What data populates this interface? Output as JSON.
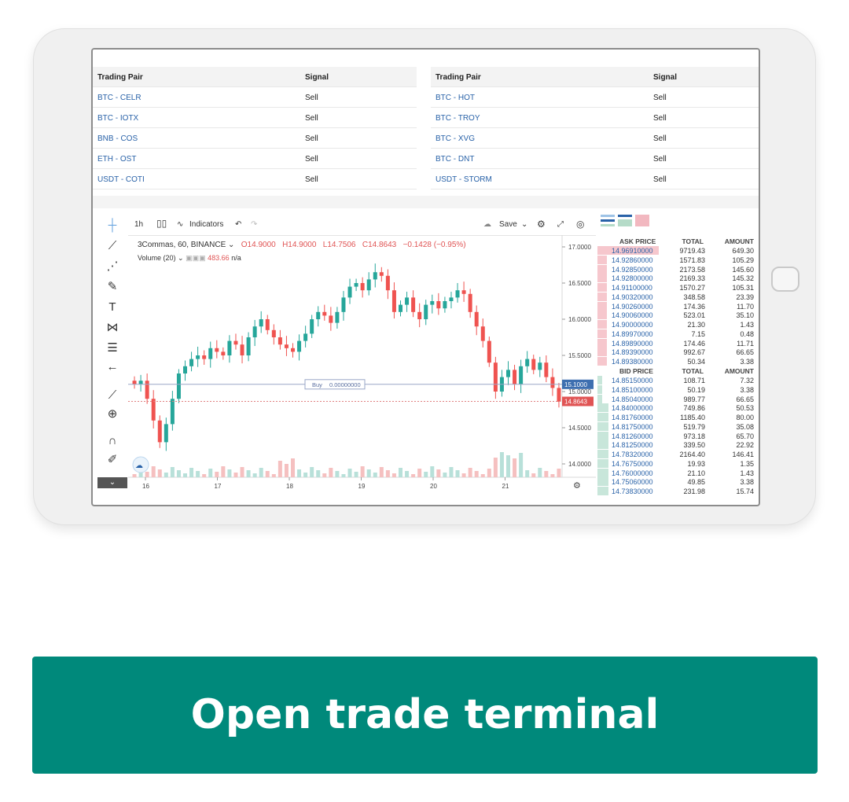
{
  "signals": {
    "headers": [
      "Trading Pair",
      "Signal"
    ],
    "left": [
      {
        "pair": "BTC - CELR",
        "signal": "Sell"
      },
      {
        "pair": "BTC - IOTX",
        "signal": "Sell"
      },
      {
        "pair": "BNB - COS",
        "signal": "Sell"
      },
      {
        "pair": "ETH - OST",
        "signal": "Sell"
      },
      {
        "pair": "USDT - COTI",
        "signal": "Sell"
      }
    ],
    "right": [
      {
        "pair": "BTC - HOT",
        "signal": "Sell"
      },
      {
        "pair": "BTC - TROY",
        "signal": "Sell"
      },
      {
        "pair": "BTC - XVG",
        "signal": "Sell"
      },
      {
        "pair": "BTC - DNT",
        "signal": "Sell"
      },
      {
        "pair": "USDT - STORM",
        "signal": "Sell"
      }
    ]
  },
  "toolbar": {
    "interval": "1h",
    "indicators": "Indicators",
    "save": "Save"
  },
  "legend": {
    "symbol": "3Commas, 60, BINANCE",
    "open": "O14.9000",
    "high": "H14.9000",
    "low": "L14.7506",
    "close": "C14.8643",
    "change": "−0.1428 (−0.95%)",
    "volume_label": "Volume (20)",
    "volume_value": "483.66",
    "volume_na": "n/a"
  },
  "order_line": {
    "label": "Buy",
    "value": "0.00000000"
  },
  "price_badges": {
    "buy": "15.1000",
    "current": "14.8643"
  },
  "colors": {
    "up": "#26a69a",
    "down": "#ef5350",
    "accent": "#00897b",
    "link": "#2962a8"
  },
  "chart_data": {
    "type": "candlestick",
    "x_ticks": [
      "16",
      "17",
      "18",
      "19",
      "20",
      "21"
    ],
    "y_ticks": [
      "17.0000",
      "16.5000",
      "16.0000",
      "15.5000",
      "15.0000",
      "14.5000",
      "14.0000"
    ],
    "ylim": [
      13.8,
      17.1
    ],
    "close_path": [
      15.1,
      15.15,
      14.9,
      14.6,
      14.3,
      14.55,
      14.9,
      15.25,
      15.35,
      15.45,
      15.5,
      15.45,
      15.6,
      15.55,
      15.5,
      15.7,
      15.65,
      15.5,
      15.75,
      15.9,
      16.0,
      15.85,
      15.75,
      15.65,
      15.6,
      15.55,
      15.7,
      15.8,
      16.0,
      16.1,
      16.05,
      15.95,
      16.1,
      16.3,
      16.45,
      16.5,
      16.4,
      16.55,
      16.65,
      16.6,
      16.4,
      16.1,
      16.2,
      16.3,
      16.1,
      16.0,
      16.2,
      16.25,
      16.15,
      16.25,
      16.3,
      16.4,
      16.35,
      16.1,
      15.9,
      15.7,
      15.4,
      15.0,
      15.2,
      15.3,
      15.1,
      15.35,
      15.45,
      15.3,
      15.4,
      15.2,
      15.05,
      14.86
    ]
  },
  "orderbook": {
    "ask_headers": [
      "ASK PRICE",
      "TOTAL",
      "AMOUNT"
    ],
    "asks": [
      [
        "14.96910000",
        "9719.43",
        "649.30"
      ],
      [
        "14.92860000",
        "1571.83",
        "105.29"
      ],
      [
        "14.92850000",
        "2173.58",
        "145.60"
      ],
      [
        "14.92800000",
        "2169.33",
        "145.32"
      ],
      [
        "14.91100000",
        "1570.27",
        "105.31"
      ],
      [
        "14.90320000",
        "348.58",
        "23.39"
      ],
      [
        "14.90260000",
        "174.36",
        "11.70"
      ],
      [
        "14.90060000",
        "523.01",
        "35.10"
      ],
      [
        "14.90000000",
        "21.30",
        "1.43"
      ],
      [
        "14.89970000",
        "7.15",
        "0.48"
      ],
      [
        "14.89890000",
        "174.46",
        "11.71"
      ],
      [
        "14.89390000",
        "992.67",
        "66.65"
      ],
      [
        "14.89380000",
        "50.34",
        "3.38"
      ]
    ],
    "bid_headers": [
      "BID PRICE",
      "TOTAL",
      "AMOUNT"
    ],
    "bids": [
      [
        "14.85150000",
        "108.71",
        "7.32"
      ],
      [
        "14.85100000",
        "50.19",
        "3.38"
      ],
      [
        "14.85040000",
        "989.77",
        "66.65"
      ],
      [
        "14.84000000",
        "749.86",
        "50.53"
      ],
      [
        "14.81760000",
        "1185.40",
        "80.00"
      ],
      [
        "14.81750000",
        "519.79",
        "35.08"
      ],
      [
        "14.81260000",
        "973.18",
        "65.70"
      ],
      [
        "14.81250000",
        "339.50",
        "22.92"
      ],
      [
        "14.78320000",
        "2164.40",
        "146.41"
      ],
      [
        "14.76750000",
        "19.93",
        "1.35"
      ],
      [
        "14.76000000",
        "21.10",
        "1.43"
      ],
      [
        "14.75060000",
        "49.85",
        "3.38"
      ],
      [
        "14.73830000",
        "231.98",
        "15.74"
      ]
    ]
  },
  "cta": {
    "label": "Open trade terminal"
  }
}
